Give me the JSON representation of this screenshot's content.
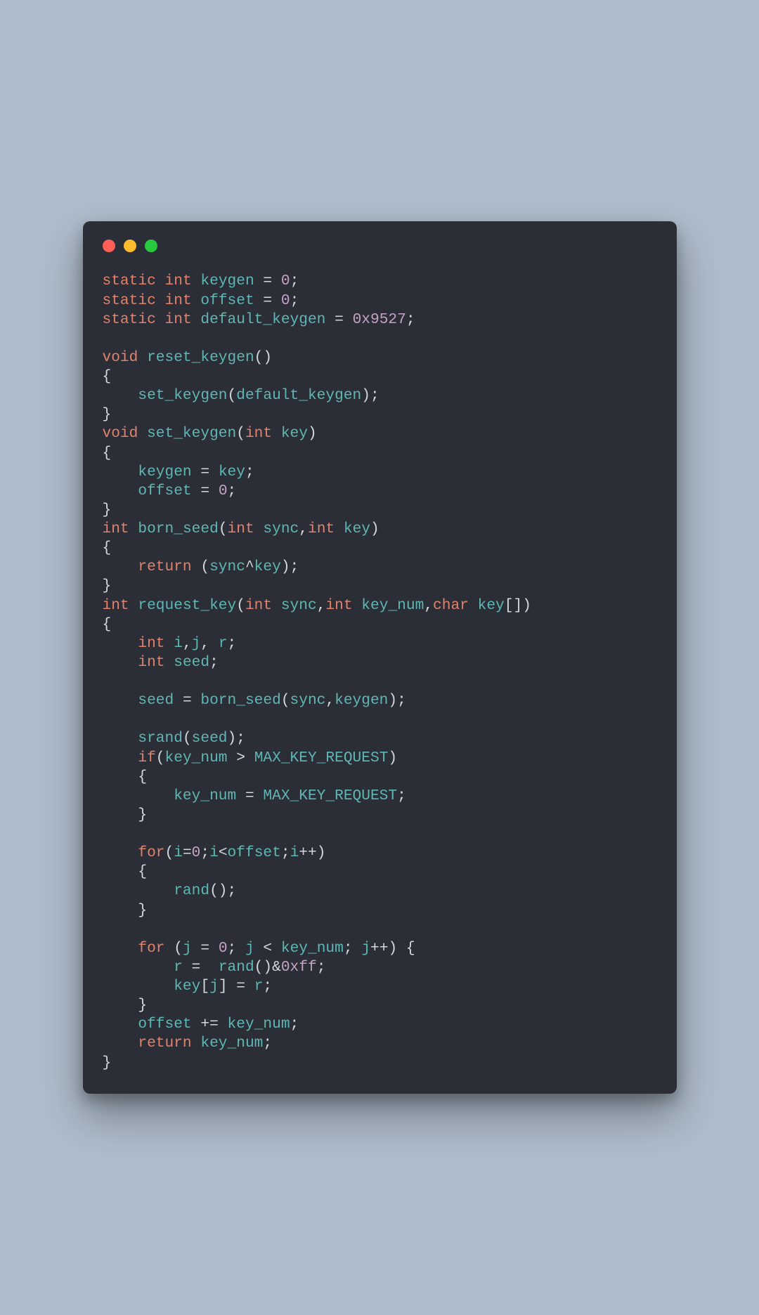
{
  "tokens": {
    "kw_static": "static",
    "kw_int": "int",
    "kw_void": "void",
    "kw_char": "char",
    "kw_return": "return",
    "kw_if": "if",
    "kw_for": "for",
    "id_keygen": "keygen",
    "id_offset": "offset",
    "id_default_keygen": "default_keygen",
    "id_reset_keygen": "reset_keygen",
    "id_set_keygen": "set_keygen",
    "id_key": "key",
    "id_born_seed": "born_seed",
    "id_sync": "sync",
    "id_request_key": "request_key",
    "id_key_num": "key_num",
    "id_i": "i",
    "id_j": "j",
    "id_r": "r",
    "id_seed": "seed",
    "id_srand": "srand",
    "id_rand": "rand",
    "id_MAX_KEY_REQUEST": "MAX_KEY_REQUEST",
    "num_0": "0",
    "num_hex9527": "0x9527",
    "num_0xff": "0xff"
  }
}
